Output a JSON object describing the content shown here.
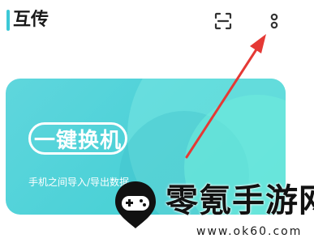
{
  "header": {
    "title": "互传",
    "accent_color": "#3cc8d6",
    "scan_icon": "scan-icon",
    "more_icon": "more-vertical-icon"
  },
  "card": {
    "button_label": "一键换机",
    "description": "手机之间导入/导出数据。",
    "color": "#4fd2d8"
  },
  "annotation": {
    "arrow_color": "#e53935"
  },
  "watermark": {
    "name": "零氪手游网",
    "url": "www.ok60.com"
  }
}
